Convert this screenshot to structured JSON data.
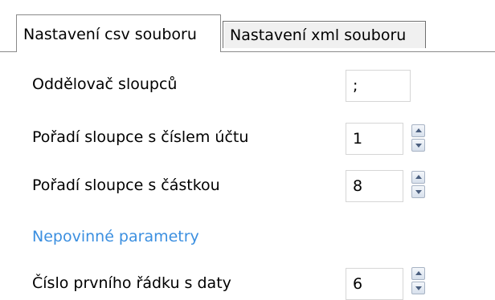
{
  "tabs": [
    {
      "label": "Nastavení csv souboru",
      "active": true
    },
    {
      "label": "Nastavení xml souboru",
      "active": false
    }
  ],
  "fields": {
    "separator": {
      "label": "Oddělovač sloupců",
      "value": ";"
    },
    "account_column": {
      "label": "Pořadí sloupce s číslem účtu",
      "value": "1"
    },
    "amount_column": {
      "label": "Pořadí sloupce s částkou",
      "value": "8"
    },
    "optional_heading": "Nepovinné parametry",
    "first_data_row": {
      "label": "Číslo prvního řádku s daty",
      "value": "6"
    }
  },
  "icons": {
    "spinner_up": "arrow-up-icon",
    "spinner_down": "arrow-down-icon"
  }
}
